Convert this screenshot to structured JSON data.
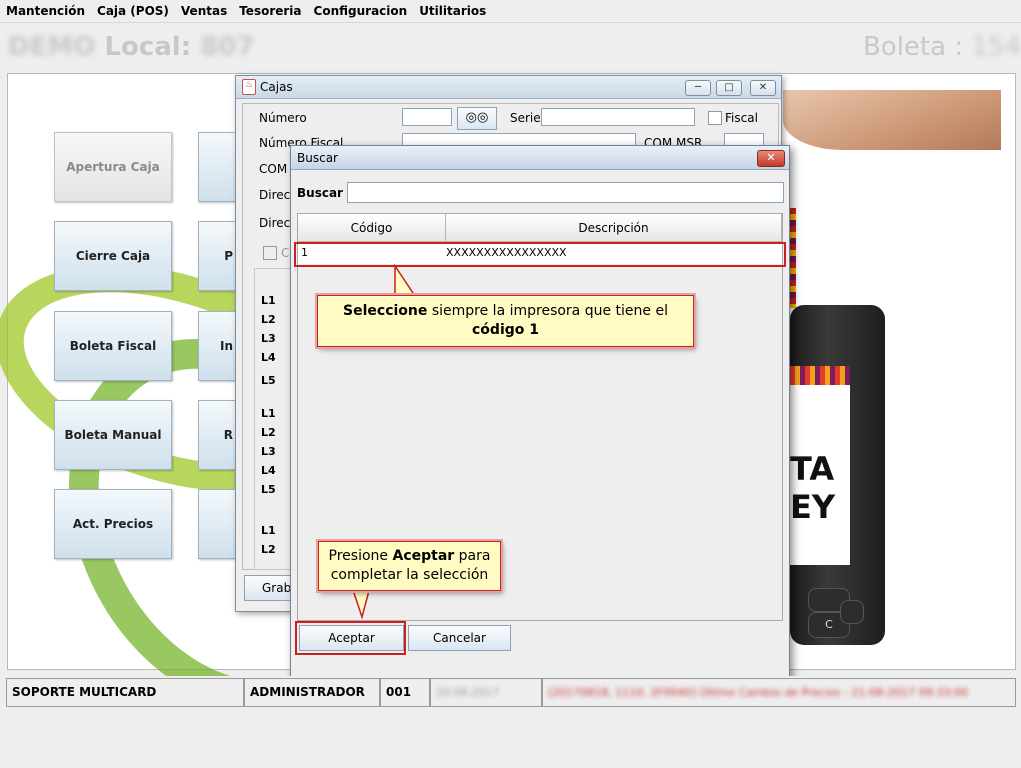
{
  "menu": [
    "Mantención",
    "Caja (POS)",
    "Ventas",
    "Tesoreria",
    "Configuracion",
    "Utilitarios"
  ],
  "header": {
    "left_prefix": "DEMO",
    "left_label": "Local:",
    "left_value": "807",
    "right_label": "Boleta :",
    "right_value": "154"
  },
  "main_buttons": [
    "Apertura Caja",
    "Cierre Caja",
    "Boleta Fiscal",
    "Boleta Manual",
    "Act. Precios"
  ],
  "second_column_partial": [
    "P",
    "In",
    "R"
  ],
  "device_text": [
    "TA",
    "EY"
  ],
  "device_key": "C",
  "cajas": {
    "title": "Cajas",
    "numero_label": "Número",
    "serie_label": "Serie",
    "fiscal_label": "Fiscal",
    "numero_fiscal_label": "Número Fiscal",
    "com_msr_label": "COM MSR",
    "com_label": "COM",
    "direc_label_1": "Direc",
    "direc_label_2": "Direc",
    "checkbox_label": "C",
    "line_labels_a": [
      "L1",
      "L2",
      "L3",
      "L4",
      "L5"
    ],
    "line_labels_b": [
      "L1",
      "L2",
      "L3",
      "L4",
      "L5"
    ],
    "line_labels_c": [
      "L1",
      "L2"
    ],
    "grabar_label": "Grab"
  },
  "buscar": {
    "title": "Buscar",
    "search_label": "Buscar",
    "search_value": "",
    "col_codigo": "Código",
    "col_descripcion": "Descripción",
    "rows": [
      {
        "codigo": "1",
        "descripcion": "XXXXXXXXXXXXXXXX"
      }
    ],
    "accept_label": "Aceptar",
    "cancel_label": "Cancelar"
  },
  "callout1": {
    "bold1": "Seleccione",
    "text1": " siempre la impresora que tiene el",
    "bold2": "código 1"
  },
  "callout2": {
    "text1": "Presione ",
    "bold1": "Aceptar",
    "text2": " para",
    "text3": "completar la selección"
  },
  "status": {
    "soporte": "SOPORTE MULTICARD",
    "usuario": "ADMINISTRADOR",
    "caja": "001",
    "fecha": "20.08.2017",
    "mensaje": "[20170818, 1110, 2F0040] Último Cambio de Precios : 21-08-2017 09:33:00"
  },
  "colors": {
    "highlight_red": "#cc1f1f",
    "callout_fill": "#fffbc3",
    "status_message_red": "#c83232"
  }
}
